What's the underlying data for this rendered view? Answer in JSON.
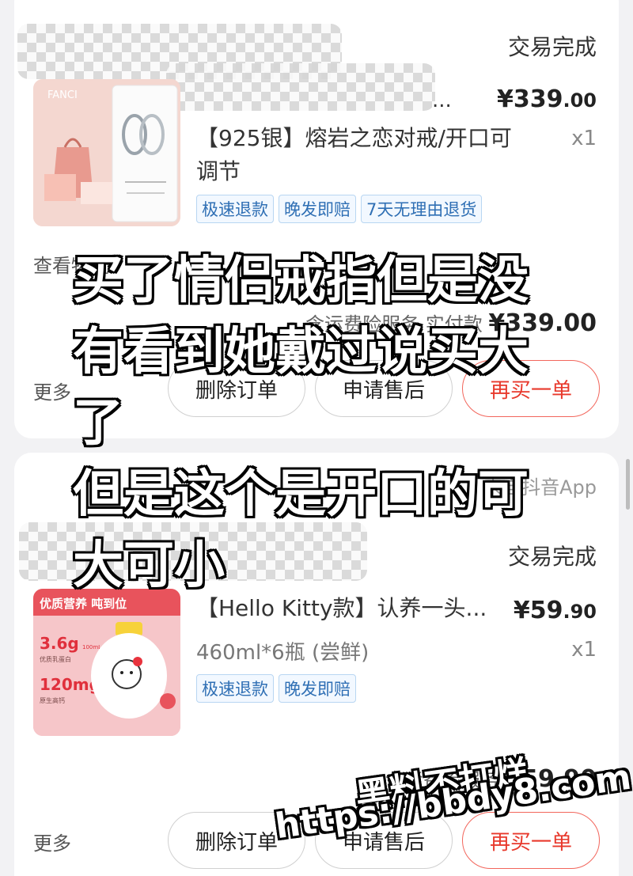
{
  "orders": [
    {
      "status": "交易完成",
      "shop_name_truncated": "...",
      "price_main": "¥339",
      "price_decimal": ".00",
      "title_line1": "【925银】熔岩之恋对戒/开口可",
      "title_line2": "调节",
      "quantity": "x1",
      "tags": [
        "极速退款",
        "晚发即赔",
        "7天无理由退货"
      ],
      "logistics_text": "查看物流",
      "paid_label": "含运费险服务  实付款",
      "paid_amount": "¥339.00",
      "more_label": "更多",
      "buttons": {
        "delete": "删除订单",
        "after_sale": "申请售后",
        "rebuy": "再买一单"
      }
    },
    {
      "source": "来自抖音App",
      "status": "交易完成",
      "price_main": "¥59",
      "price_decimal": ".90",
      "title_line1": "【Hello Kitty款】认养一头...",
      "spec": "460ml*6瓶 (尝鲜)",
      "quantity": "x1",
      "tags": [
        "极速退款",
        "晚发即赔"
      ],
      "paid_label": "含运费险服务",
      "paid_amount": "¥59.90",
      "more_label": "更多",
      "buttons": {
        "delete": "删除订单",
        "after_sale": "申请售后",
        "rebuy": "再买一单"
      }
    }
  ],
  "overlay_caption": "买了情侣戒指但是没\n有看到她戴过说买大\n了\n但是这个是开口的可\n大可小",
  "watermark": {
    "line1": "黑料不打烊",
    "line2": "https://bbdy8.com"
  },
  "product_images": {
    "ring_box_brand": "FANCI",
    "milk_banner": "优质营养 吨到位",
    "milk_stat1_value": "3.6g",
    "milk_stat1_unit": "100mL",
    "milk_stat1_label": "优质乳蛋白",
    "milk_stat2_value": "120mg",
    "milk_stat2_unit": "100mL",
    "milk_stat2_label": "原生高钙"
  },
  "colors": {
    "accent_red": "#e8392c",
    "tag_blue": "#2f6fb4"
  }
}
